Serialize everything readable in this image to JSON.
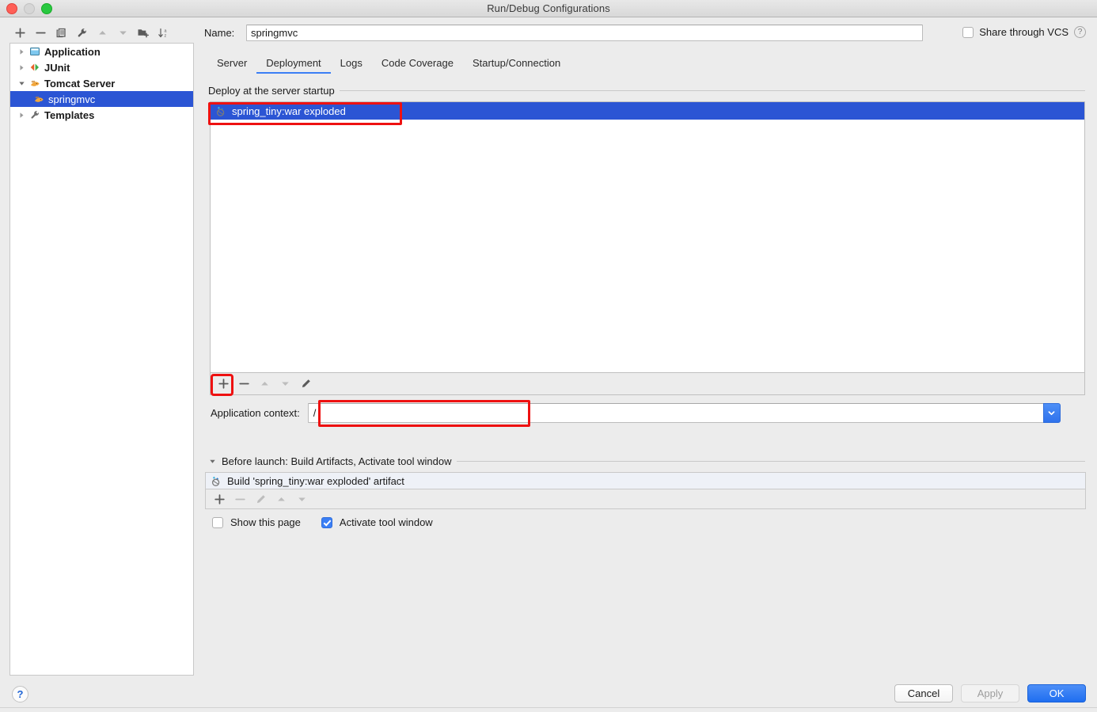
{
  "window": {
    "title": "Run/Debug Configurations",
    "traffic_lights": [
      "close",
      "minimize",
      "zoom"
    ]
  },
  "left_toolbar": {
    "buttons": [
      {
        "name": "add",
        "icon": "plus-icon",
        "enabled": true
      },
      {
        "name": "remove",
        "icon": "minus-icon",
        "enabled": true
      },
      {
        "name": "copy",
        "icon": "copy-icon",
        "enabled": true
      },
      {
        "name": "edit-templates",
        "icon": "wrench-icon",
        "enabled": true
      },
      {
        "name": "move-up",
        "icon": "arrow-up-icon",
        "enabled": false
      },
      {
        "name": "move-down",
        "icon": "arrow-down-icon",
        "enabled": false
      },
      {
        "name": "create-folder",
        "icon": "folder-add-icon",
        "enabled": true
      },
      {
        "name": "sort",
        "icon": "sort-az-icon",
        "enabled": true
      }
    ]
  },
  "tree": {
    "items": [
      {
        "label": "Application",
        "icon": "application-icon",
        "expanded": false,
        "has_children": true,
        "selected": false,
        "level": 0
      },
      {
        "label": "JUnit",
        "icon": "junit-icon",
        "expanded": false,
        "has_children": true,
        "selected": false,
        "level": 0
      },
      {
        "label": "Tomcat Server",
        "icon": "tomcat-icon",
        "expanded": true,
        "has_children": true,
        "selected": false,
        "level": 0
      },
      {
        "label": "springmvc",
        "icon": "tomcat-icon",
        "expanded": false,
        "has_children": false,
        "selected": true,
        "level": 1
      },
      {
        "label": "Templates",
        "icon": "wrench-icon",
        "expanded": false,
        "has_children": true,
        "selected": false,
        "level": 0
      }
    ]
  },
  "name_field": {
    "label": "Name:",
    "value": "springmvc",
    "placeholder": ""
  },
  "share_vcs": {
    "label": "Share through VCS",
    "checked": false,
    "help_glyph": "?"
  },
  "tabs": {
    "items": [
      {
        "label": "Server",
        "active": false
      },
      {
        "label": "Deployment",
        "active": true
      },
      {
        "label": "Logs",
        "active": false
      },
      {
        "label": "Code Coverage",
        "active": false
      },
      {
        "label": "Startup/Connection",
        "active": false
      }
    ]
  },
  "deployment": {
    "group_title": "Deploy at the server startup",
    "rows": [
      {
        "label": "spring_tiny:war exploded",
        "icon": "artifact-icon",
        "selected": true
      }
    ],
    "toolbar": [
      {
        "name": "add-artifact",
        "icon": "plus-icon",
        "enabled": true
      },
      {
        "name": "remove-artifact",
        "icon": "minus-icon",
        "enabled": true
      },
      {
        "name": "move-up-artifact",
        "icon": "arrow-up-icon",
        "enabled": false
      },
      {
        "name": "move-down-artifact",
        "icon": "arrow-down-icon",
        "enabled": false
      },
      {
        "name": "edit-artifact",
        "icon": "pencil-icon",
        "enabled": true
      }
    ]
  },
  "application_context": {
    "label": "Application context:",
    "value": "/",
    "placeholder": "",
    "dropdown_icon": "chevron-down-icon"
  },
  "before_launch": {
    "title": "Before launch: Build Artifacts, Activate tool window",
    "expanded": true,
    "rows": [
      {
        "label": "Build 'spring_tiny:war exploded' artifact",
        "icon": "artifact-icon"
      }
    ],
    "toolbar": [
      {
        "name": "add-task",
        "icon": "plus-icon",
        "enabled": true
      },
      {
        "name": "remove-task",
        "icon": "minus-icon",
        "enabled": false
      },
      {
        "name": "edit-task",
        "icon": "pencil-icon",
        "enabled": false
      },
      {
        "name": "move-up-task",
        "icon": "arrow-up-icon",
        "enabled": false
      },
      {
        "name": "move-down-task",
        "icon": "arrow-down-icon",
        "enabled": false
      }
    ],
    "checkboxes": [
      {
        "label": "Show this page",
        "checked": false
      },
      {
        "label": "Activate tool window",
        "checked": true
      }
    ]
  },
  "footer": {
    "help_glyph": "?",
    "buttons": [
      {
        "label": "Cancel",
        "style": "default",
        "enabled": true
      },
      {
        "label": "Apply",
        "style": "disabled",
        "enabled": false
      },
      {
        "label": "OK",
        "style": "primary",
        "enabled": true
      }
    ]
  },
  "annotations": {
    "highlight_color": "#ee1111",
    "boxes": [
      {
        "name": "artifact-row-highlight",
        "target": "spring_tiny:war exploded"
      },
      {
        "name": "add-artifact-highlight",
        "target": "+"
      },
      {
        "name": "application-context-highlight",
        "target": "/"
      }
    ]
  },
  "colors": {
    "accent_blue": "#3b7ff5",
    "selection_blue": "#2b55d4",
    "dialog_bg": "#ececec",
    "panel_bg": "#ffffff",
    "annotation_red": "#ee1111"
  }
}
